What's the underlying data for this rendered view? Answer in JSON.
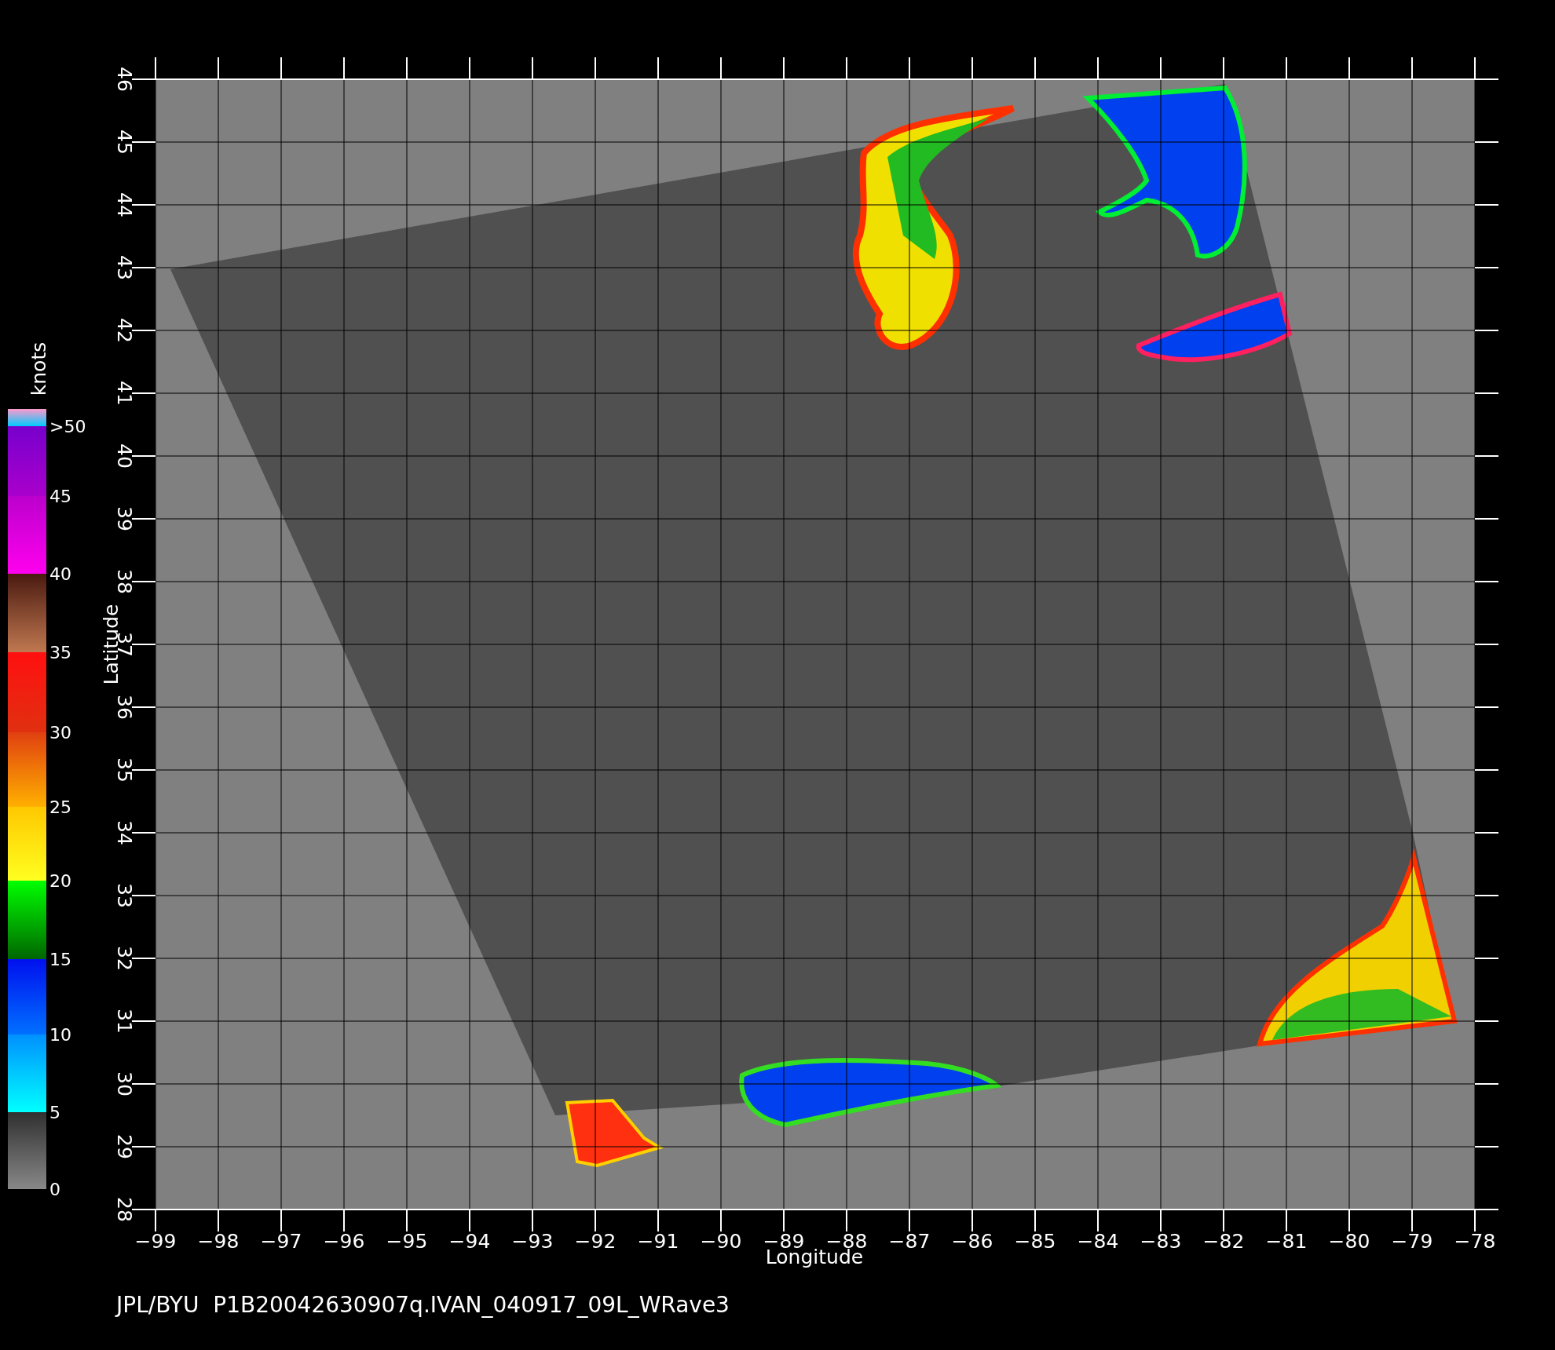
{
  "colorbar": {
    "title": "knots",
    "labels": [
      ">50",
      "45",
      "40",
      "35",
      "30",
      "25",
      "20",
      "15",
      "10",
      "5",
      "0"
    ]
  },
  "y_axis": {
    "label": "Latitude",
    "ticks": [
      "46",
      "45",
      "44",
      "43",
      "42",
      "41",
      "40",
      "39",
      "38",
      "37",
      "36",
      "35",
      "34",
      "33",
      "32",
      "31",
      "30",
      "29",
      "28"
    ]
  },
  "x_axis": {
    "label": "Longitude",
    "ticks": [
      "−99",
      "−98",
      "−97",
      "−96",
      "−95",
      "−94",
      "−93",
      "−92",
      "−91",
      "−90",
      "−89",
      "−88",
      "−87",
      "−86",
      "−85",
      "−84",
      "−83",
      "−82",
      "−81",
      "−80",
      "−79",
      "−78"
    ]
  },
  "footer": "JPL/BYU  P1B20042630907q.IVAN_040917_09L_WRave3"
}
